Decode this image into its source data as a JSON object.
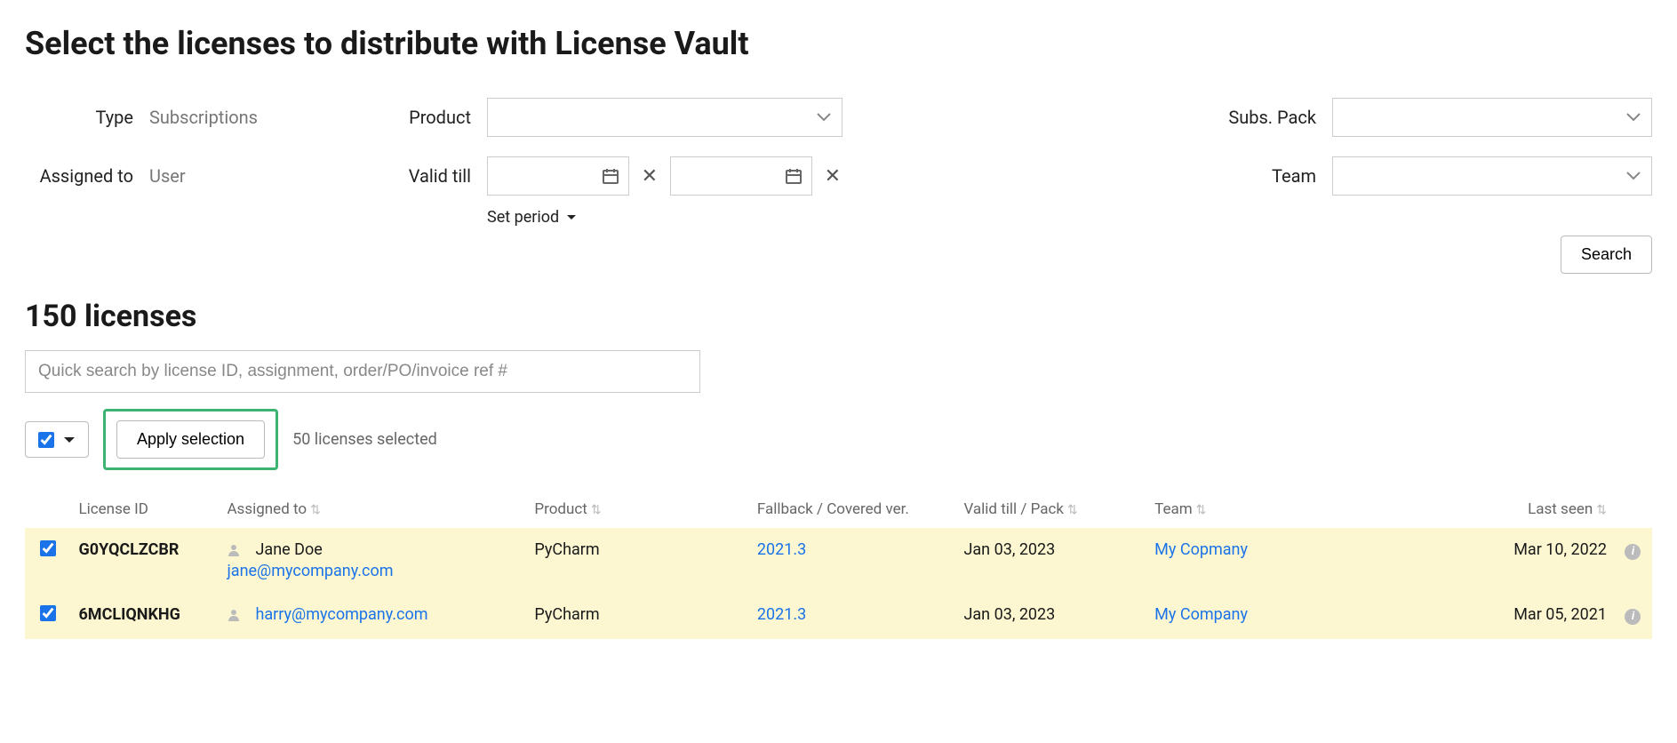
{
  "title": "Select the licenses to distribute with License Vault",
  "filters": {
    "type_label": "Type",
    "type_value": "Subscriptions",
    "assigned_label": "Assigned to",
    "assigned_value": "User",
    "product_label": "Product",
    "product_value": "",
    "valid_label": "Valid till",
    "valid_from": "",
    "valid_to": "",
    "set_period_label": "Set period",
    "subs_pack_label": "Subs. Pack",
    "subs_pack_value": "",
    "team_label": "Team",
    "team_value": "",
    "search_button": "Search"
  },
  "results": {
    "heading": "150 licenses",
    "quick_search_placeholder": "Quick search by license ID, assignment, order/PO/invoice ref #",
    "apply_button": "Apply selection",
    "selected_text": "50 licenses selected"
  },
  "columns": {
    "license_id": "License ID",
    "assigned_to": "Assigned to",
    "product": "Product",
    "fallback": "Fallback / Covered ver.",
    "valid_till": "Valid till / Pack",
    "team": "Team",
    "last_seen": "Last seen"
  },
  "rows": [
    {
      "checked": true,
      "license_id": "G0YQCLZCBR",
      "assigned_name": "Jane Doe",
      "assigned_email": "jane@mycompany.com",
      "assigned_name_is_link": false,
      "product": "PyCharm",
      "fallback": "2021.3",
      "valid_till": "Jan 03, 2023",
      "team": "My Copmany",
      "last_seen": "Mar 10, 2022"
    },
    {
      "checked": true,
      "license_id": "6MCLIQNKHG",
      "assigned_name": "harry@mycompany.com",
      "assigned_email": "",
      "assigned_name_is_link": true,
      "product": "PyCharm",
      "fallback": "2021.3",
      "valid_till": "Jan 03, 2023",
      "team": "My Company",
      "last_seen": "Mar 05, 2021"
    }
  ]
}
